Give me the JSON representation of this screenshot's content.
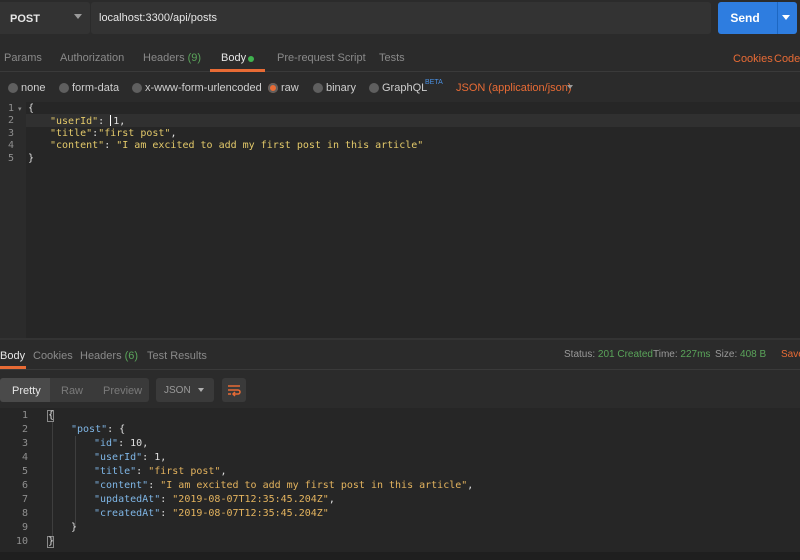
{
  "request": {
    "method": "POST",
    "url": "localhost:3300/api/posts",
    "send_label": "Send"
  },
  "tabs": {
    "params": "Params",
    "authorization": "Authorization",
    "headers": "Headers",
    "headers_count": "(9)",
    "body": "Body",
    "prerequest": "Pre-request Script",
    "tests": "Tests",
    "cookies": "Cookies",
    "code": "Code"
  },
  "body_types": {
    "none": "none",
    "form_data": "form-data",
    "urlencoded": "x-www-form-urlencoded",
    "raw": "raw",
    "binary": "binary",
    "graphql": "GraphQL",
    "beta": "BETA",
    "selected": "raw",
    "content_type": "JSON (application/json)"
  },
  "request_body": {
    "line_numbers": [
      "1",
      "2",
      "3",
      "4",
      "5"
    ],
    "lines": {
      "l1": "{",
      "l2_key": "\"userId\"",
      "l2_sep": ": ",
      "l2_val": "1,",
      "l3_key": "\"title\"",
      "l3_sep": ":",
      "l3_val": "\"first post\"",
      "l3_end": ",",
      "l4_key": "\"content\"",
      "l4_sep": ": ",
      "l4_val": "\"I am excited to add my first post in this article\"",
      "l5": "}"
    }
  },
  "response_tabs": {
    "body": "Body",
    "cookies": "Cookies",
    "headers": "Headers",
    "headers_count": "(6)",
    "test_results": "Test Results"
  },
  "response_status": {
    "status_label": "Status:",
    "status_value": "201 Created",
    "time_label": "Time:",
    "time_value": "227ms",
    "size_label": "Size:",
    "size_value": "408 B",
    "save_label": "Save"
  },
  "response_toolbar": {
    "pretty": "Pretty",
    "raw": "Raw",
    "preview": "Preview",
    "format": "JSON",
    "wrap_icon": "wrap-lines-icon"
  },
  "response_body": {
    "line_numbers": [
      "1",
      "2",
      "3",
      "4",
      "5",
      "6",
      "7",
      "8",
      "9",
      "10"
    ],
    "lines": {
      "l1": "{",
      "l2_key": "\"post\"",
      "l2_rest": ": {",
      "l3_key": "\"id\"",
      "l3_sep": ": ",
      "l3_val": "10",
      "l3_end": ",",
      "l4_key": "\"userId\"",
      "l4_sep": ": ",
      "l4_val": "1",
      "l4_end": ",",
      "l5_key": "\"title\"",
      "l5_sep": ": ",
      "l5_val": "\"first post\"",
      "l5_end": ",",
      "l6_key": "\"content\"",
      "l6_sep": ": ",
      "l6_val": "\"I am excited to add my first post in this article\"",
      "l6_end": ",",
      "l7_key": "\"updatedAt\"",
      "l7_sep": ": ",
      "l7_val": "\"2019-08-07T12:35:45.204Z\"",
      "l7_end": ",",
      "l8_key": "\"createdAt\"",
      "l8_sep": ": ",
      "l8_val": "\"2019-08-07T12:35:45.204Z\"",
      "l9": "}",
      "l10": "}"
    }
  },
  "colors": {
    "accent": "#e86b35",
    "send": "#2e7de0",
    "success": "#5aa45a",
    "string": "#e3b35e",
    "key": "#7fb6e6"
  }
}
